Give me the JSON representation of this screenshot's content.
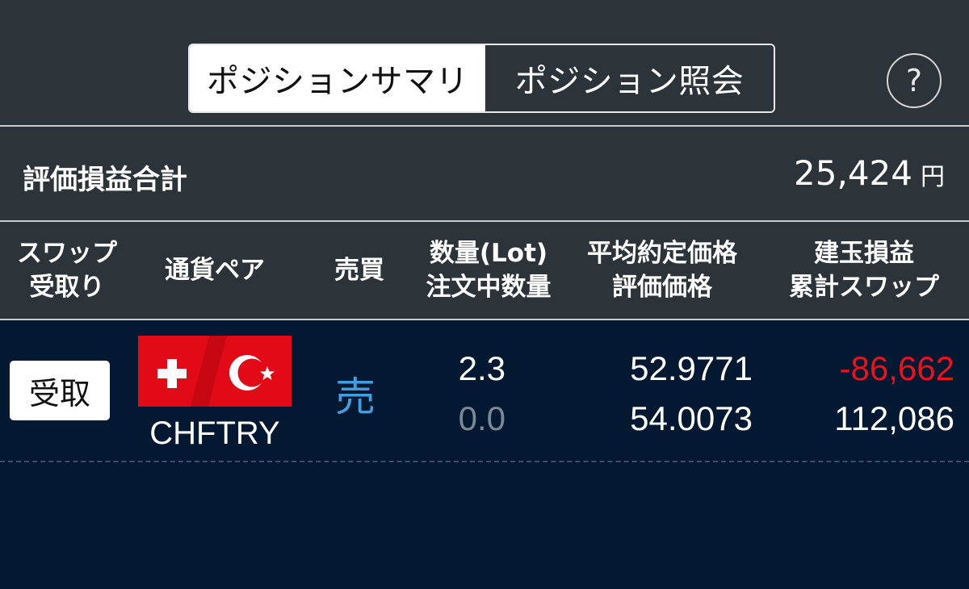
{
  "tabs": {
    "summary_label": "ポジションサマリ",
    "inquiry_label": "ポジション照会",
    "active": "summary"
  },
  "help": {
    "label": "?"
  },
  "summary": {
    "label": "評価損益合計",
    "value": "25,424",
    "unit": "円"
  },
  "table": {
    "headers": {
      "swap_receive": [
        "スワップ",
        "受取り"
      ],
      "pair": [
        "通貨ペア"
      ],
      "side": [
        "売買"
      ],
      "quantity": [
        "数量(Lot)",
        "注文中数量"
      ],
      "price": [
        "平均約定価格",
        "評価価格"
      ],
      "pnl": [
        "建玉損益",
        "累計スワップ"
      ]
    },
    "rows": [
      {
        "receive_button": "受取",
        "pair": "CHFTRY",
        "side": "売",
        "quantity": "2.3",
        "order_quantity": "0.0",
        "avg_price": "52.9771",
        "eval_price": "54.0073",
        "pnl": "-86,662",
        "swap": "112,086"
      }
    ]
  },
  "colors": {
    "background_top": "#2c3339",
    "background_body": "#031931",
    "negative": "#e8141c",
    "sell": "#3f9fe0",
    "muted": "#7b8895",
    "flag_red": "#e30a17"
  }
}
